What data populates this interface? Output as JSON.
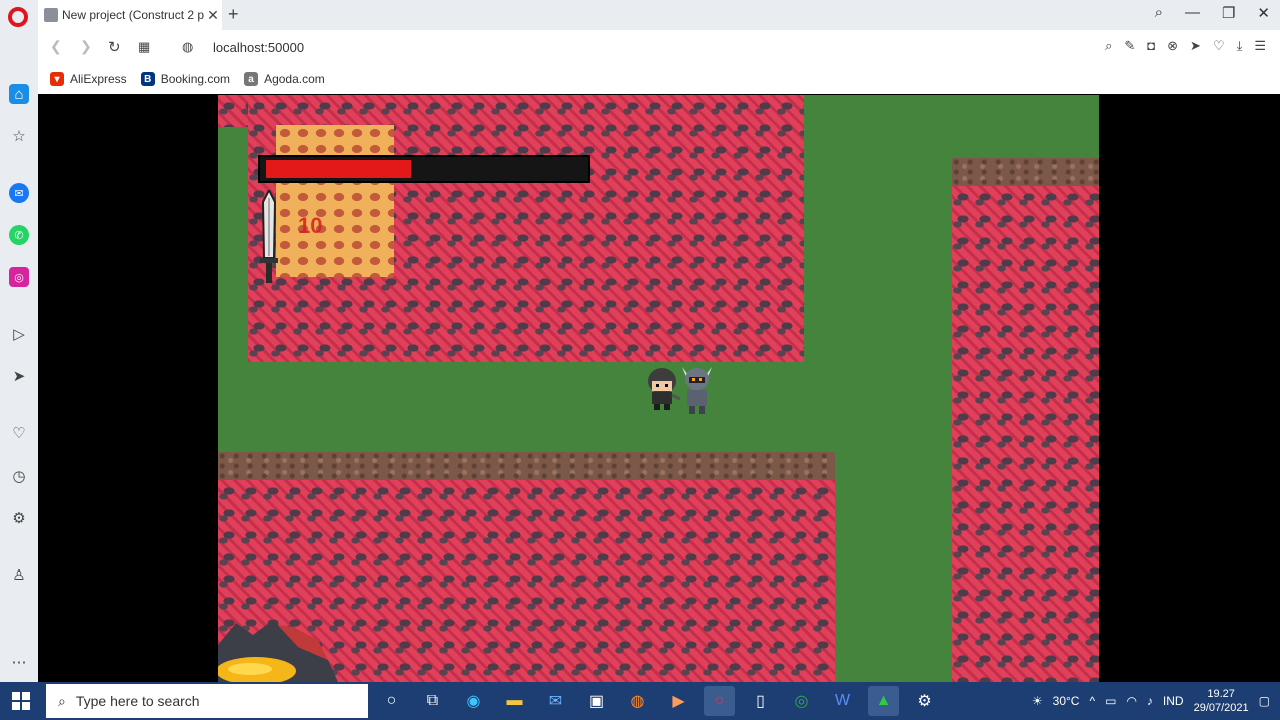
{
  "browser": {
    "tab_title": "New project (Construct 2 p",
    "url": "localhost:50000",
    "bookmarks": [
      {
        "label": "AliExpress",
        "icon": "aliexpress-icon",
        "color": "#e62e04"
      },
      {
        "label": "Booking.com",
        "icon": "booking-icon",
        "color": "#003580"
      },
      {
        "label": "Agoda.com",
        "icon": "agoda-icon",
        "color": "#777777"
      }
    ]
  },
  "game": {
    "health_fraction": 0.46,
    "damage_text": "10",
    "colors": {
      "grass": "#44843c",
      "lava": "#e0405a",
      "health": "#e31919"
    }
  },
  "taskbar": {
    "search_placeholder": "Type here to search",
    "weather": "30°C",
    "language": "IND",
    "time": "19.27",
    "date": "29/07/2021"
  }
}
